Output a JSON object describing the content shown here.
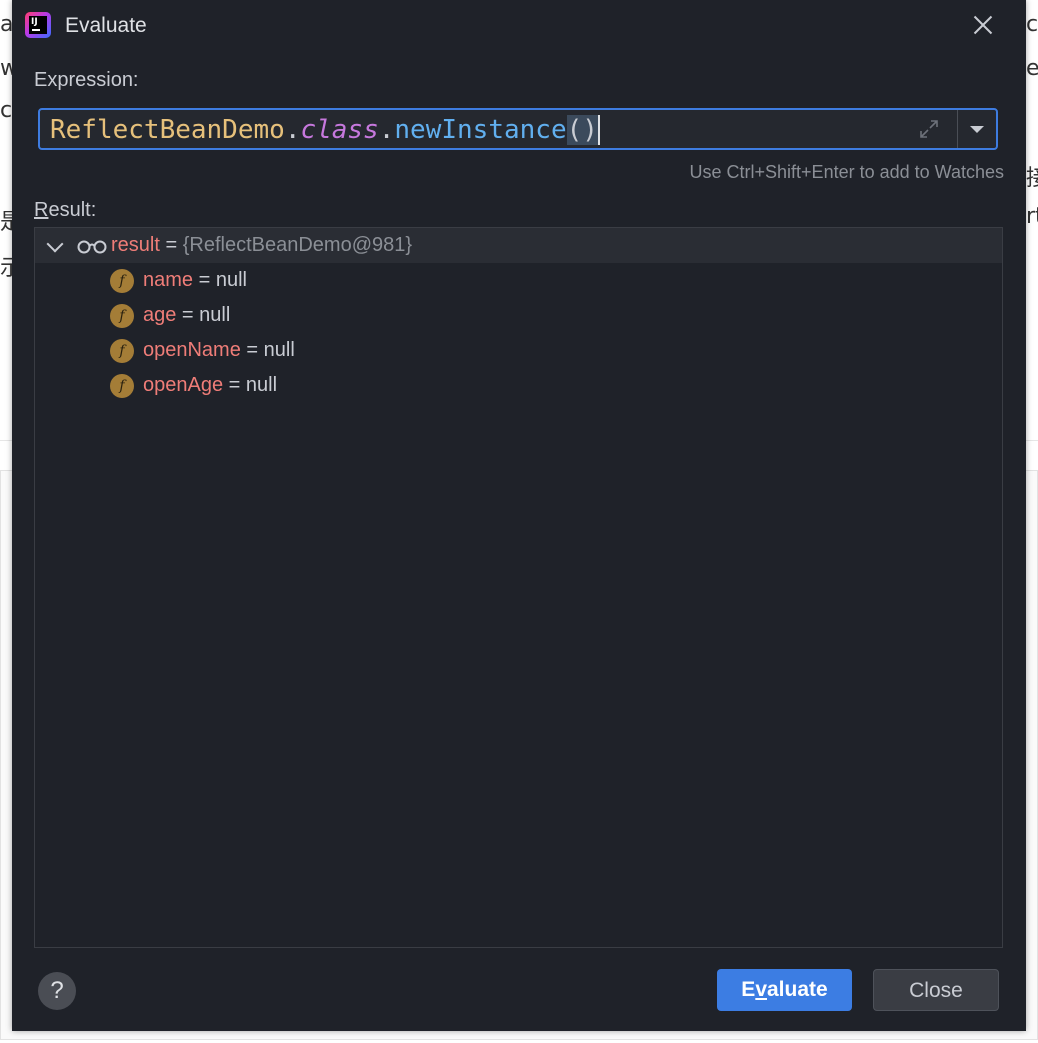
{
  "window": {
    "title": "Evaluate",
    "app_icon": "intellij-idea-icon",
    "close_icon": "close-icon"
  },
  "expression": {
    "label": "Expression:",
    "tokens": {
      "class_name": "ReflectBeanDemo",
      "dot1": ".",
      "keyword": "class",
      "dot2": ".",
      "method": "newInstance",
      "parens": "()"
    },
    "hint": "Use Ctrl+Shift+Enter to add to Watches"
  },
  "result": {
    "label_u": "R",
    "label_rest": "esult:",
    "root": {
      "name": "result",
      "eq": " = ",
      "value": "{ReflectBeanDemo@981}"
    },
    "fields": [
      {
        "icon": "f",
        "name": "name",
        "eq": " = ",
        "value": "null"
      },
      {
        "icon": "f",
        "name": "age",
        "eq": " = ",
        "value": "null"
      },
      {
        "icon": "f",
        "name": "openName",
        "eq": " = ",
        "value": "null"
      },
      {
        "icon": "f",
        "name": "openAge",
        "eq": " = ",
        "value": "null"
      }
    ]
  },
  "footer": {
    "help": "?",
    "evaluate_pre": "E",
    "evaluate_u": "v",
    "evaluate_post": "aluate",
    "close": "Close"
  },
  "background": {
    "frag_a": "a",
    "frag_w": "w",
    "frag_c": "c",
    "frag_shi": "是",
    "frag_shi2": "示",
    "frag_r1": "c",
    "frag_r2": "es",
    "frag_r3": "接",
    "frag_r4": "rt"
  },
  "colors": {
    "dialog_bg": "#1f2229",
    "accent": "#3c7de3",
    "class_token": "#e6c07b",
    "keyword_token": "#c678dd",
    "method_token": "#61afef",
    "var_name": "#ef7d78",
    "field_icon": "#a47d37"
  }
}
